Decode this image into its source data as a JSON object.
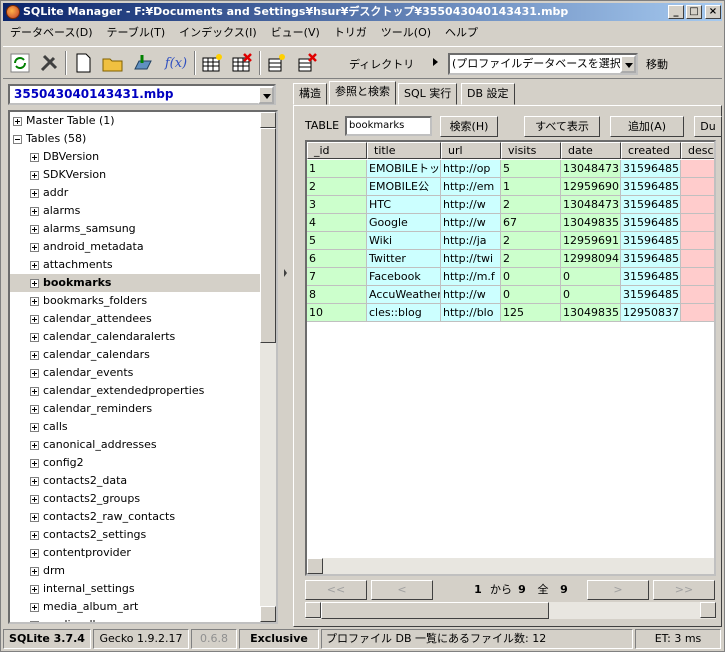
{
  "window": {
    "title": "SQLite Manager - F:¥Documents and Settings¥hsur¥デスクトップ¥355043040143431.mbp"
  },
  "menu": [
    "データベース(D)",
    "テーブル(T)",
    "インデックス(I)",
    "ビュー(V)",
    "トリガ",
    "ツール(O)",
    "ヘルプ"
  ],
  "toolbar": {
    "fx": "f(x)",
    "directory": "ディレクトリ",
    "profile_select": "(プロファイルデータベースを選択)",
    "move": "移動"
  },
  "db_select": "355043040143431.mbp",
  "tree": {
    "master": "Master Table (1)",
    "tables_header": "Tables (58)",
    "tables": [
      "DBVersion",
      "SDKVersion",
      "addr",
      "alarms",
      "alarms_samsung",
      "android_metadata",
      "attachments",
      "bookmarks",
      "bookmarks_folders",
      "calendar_attendees",
      "calendar_calendaralerts",
      "calendar_calendars",
      "calendar_events",
      "calendar_extendedproperties",
      "calendar_reminders",
      "calls",
      "canonical_addresses",
      "config2",
      "contacts2_data",
      "contacts2_groups",
      "contacts2_raw_contacts",
      "contacts2_settings",
      "contentprovider",
      "drm",
      "internal_settings",
      "media_album_art",
      "media_albums"
    ],
    "selected": "bookmarks"
  },
  "tabs": [
    "構造",
    "参照と検索",
    "SQL 実行",
    "DB 設定"
  ],
  "browse": {
    "table_label": "TABLE",
    "table_value": "bookmarks",
    "search": "検索(H)",
    "show_all": "すべて表示",
    "add": "追加(A)",
    "dup": "Du",
    "columns": [
      "_id",
      "title",
      "url",
      "visits",
      "date",
      "created",
      "descr"
    ],
    "rows": [
      [
        "1",
        "EMOBILEトッ",
        "http://op",
        "5",
        "13048473",
        "31596485",
        ""
      ],
      [
        "2",
        "EMOBILE公",
        "http://em",
        "1",
        "12959690",
        "31596485",
        ""
      ],
      [
        "3",
        "HTC",
        "http://w",
        "2",
        "13048473",
        "31596485",
        ""
      ],
      [
        "4",
        "Google",
        "http://w",
        "67",
        "13049835",
        "31596485",
        ""
      ],
      [
        "5",
        "Wiki",
        "http://ja",
        "2",
        "12959691",
        "31596485",
        ""
      ],
      [
        "6",
        "Twitter",
        "http://twi",
        "2",
        "12998094",
        "31596485",
        ""
      ],
      [
        "7",
        "Facebook",
        "http://m.f",
        "0",
        "0",
        "31596485",
        ""
      ],
      [
        "8",
        "AccuWeather",
        "http://w",
        "0",
        "0",
        "31596485",
        ""
      ],
      [
        "10",
        "cles::blog",
        "http://blo",
        "125",
        "13049835",
        "12950837",
        ""
      ]
    ],
    "nav": {
      "first": "<<",
      "prev": "<",
      "next": ">",
      "last": ">>",
      "current": "1",
      "from": "から",
      "count": "9",
      "total_label": "全",
      "total": "9"
    }
  },
  "status": {
    "sqlite": "SQLite 3.7.4",
    "gecko": "Gecko 1.9.2.17",
    "version": "0.6.8",
    "mode": "Exclusive",
    "message": "プロファイル DB 一覧にあるファイル数: 12",
    "et": "ET: 3 ms"
  },
  "colors": {
    "row_green": "#ccffcc",
    "row_cyan": "#ccffff",
    "row_pink": "#ffcccc",
    "title_start": "#0a246a"
  }
}
